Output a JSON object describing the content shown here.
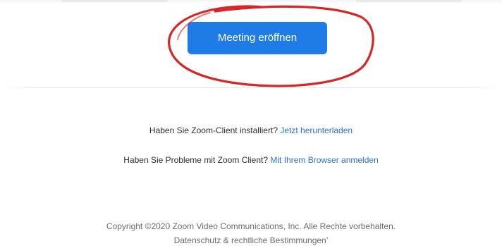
{
  "launch_meeting": {
    "label": "Meeting eröffnen",
    "button_color": "#1f7be6",
    "annotation_color": "#d41414"
  },
  "help": {
    "install_question": "Haben Sie Zoom-Client installiert?",
    "install_link": "Jetzt herunterladen",
    "problem_question": "Haben Sie Probleme mit Zoom Client?",
    "problem_link": "Mit Ihrem Browser anmelden",
    "link_color": "#2b72d8"
  },
  "footer": {
    "copyright": "Copyright ©2020 Zoom Video Communications, Inc. Alle Rechte vorbehalten.",
    "legal_link": "Datenschutz & rechtliche Bestimmungen’"
  }
}
